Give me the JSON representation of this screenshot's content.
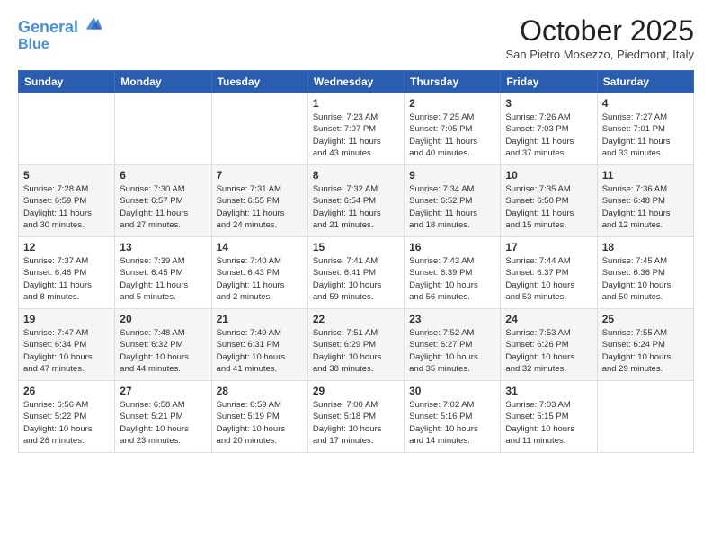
{
  "header": {
    "logo_line1": "General",
    "logo_line2": "Blue",
    "month_title": "October 2025",
    "location": "San Pietro Mosezzo, Piedmont, Italy"
  },
  "days_of_week": [
    "Sunday",
    "Monday",
    "Tuesday",
    "Wednesday",
    "Thursday",
    "Friday",
    "Saturday"
  ],
  "weeks": [
    [
      {
        "num": "",
        "info": ""
      },
      {
        "num": "",
        "info": ""
      },
      {
        "num": "",
        "info": ""
      },
      {
        "num": "1",
        "info": "Sunrise: 7:23 AM\nSunset: 7:07 PM\nDaylight: 11 hours\nand 43 minutes."
      },
      {
        "num": "2",
        "info": "Sunrise: 7:25 AM\nSunset: 7:05 PM\nDaylight: 11 hours\nand 40 minutes."
      },
      {
        "num": "3",
        "info": "Sunrise: 7:26 AM\nSunset: 7:03 PM\nDaylight: 11 hours\nand 37 minutes."
      },
      {
        "num": "4",
        "info": "Sunrise: 7:27 AM\nSunset: 7:01 PM\nDaylight: 11 hours\nand 33 minutes."
      }
    ],
    [
      {
        "num": "5",
        "info": "Sunrise: 7:28 AM\nSunset: 6:59 PM\nDaylight: 11 hours\nand 30 minutes."
      },
      {
        "num": "6",
        "info": "Sunrise: 7:30 AM\nSunset: 6:57 PM\nDaylight: 11 hours\nand 27 minutes."
      },
      {
        "num": "7",
        "info": "Sunrise: 7:31 AM\nSunset: 6:55 PM\nDaylight: 11 hours\nand 24 minutes."
      },
      {
        "num": "8",
        "info": "Sunrise: 7:32 AM\nSunset: 6:54 PM\nDaylight: 11 hours\nand 21 minutes."
      },
      {
        "num": "9",
        "info": "Sunrise: 7:34 AM\nSunset: 6:52 PM\nDaylight: 11 hours\nand 18 minutes."
      },
      {
        "num": "10",
        "info": "Sunrise: 7:35 AM\nSunset: 6:50 PM\nDaylight: 11 hours\nand 15 minutes."
      },
      {
        "num": "11",
        "info": "Sunrise: 7:36 AM\nSunset: 6:48 PM\nDaylight: 11 hours\nand 12 minutes."
      }
    ],
    [
      {
        "num": "12",
        "info": "Sunrise: 7:37 AM\nSunset: 6:46 PM\nDaylight: 11 hours\nand 8 minutes."
      },
      {
        "num": "13",
        "info": "Sunrise: 7:39 AM\nSunset: 6:45 PM\nDaylight: 11 hours\nand 5 minutes."
      },
      {
        "num": "14",
        "info": "Sunrise: 7:40 AM\nSunset: 6:43 PM\nDaylight: 11 hours\nand 2 minutes."
      },
      {
        "num": "15",
        "info": "Sunrise: 7:41 AM\nSunset: 6:41 PM\nDaylight: 10 hours\nand 59 minutes."
      },
      {
        "num": "16",
        "info": "Sunrise: 7:43 AM\nSunset: 6:39 PM\nDaylight: 10 hours\nand 56 minutes."
      },
      {
        "num": "17",
        "info": "Sunrise: 7:44 AM\nSunset: 6:37 PM\nDaylight: 10 hours\nand 53 minutes."
      },
      {
        "num": "18",
        "info": "Sunrise: 7:45 AM\nSunset: 6:36 PM\nDaylight: 10 hours\nand 50 minutes."
      }
    ],
    [
      {
        "num": "19",
        "info": "Sunrise: 7:47 AM\nSunset: 6:34 PM\nDaylight: 10 hours\nand 47 minutes."
      },
      {
        "num": "20",
        "info": "Sunrise: 7:48 AM\nSunset: 6:32 PM\nDaylight: 10 hours\nand 44 minutes."
      },
      {
        "num": "21",
        "info": "Sunrise: 7:49 AM\nSunset: 6:31 PM\nDaylight: 10 hours\nand 41 minutes."
      },
      {
        "num": "22",
        "info": "Sunrise: 7:51 AM\nSunset: 6:29 PM\nDaylight: 10 hours\nand 38 minutes."
      },
      {
        "num": "23",
        "info": "Sunrise: 7:52 AM\nSunset: 6:27 PM\nDaylight: 10 hours\nand 35 minutes."
      },
      {
        "num": "24",
        "info": "Sunrise: 7:53 AM\nSunset: 6:26 PM\nDaylight: 10 hours\nand 32 minutes."
      },
      {
        "num": "25",
        "info": "Sunrise: 7:55 AM\nSunset: 6:24 PM\nDaylight: 10 hours\nand 29 minutes."
      }
    ],
    [
      {
        "num": "26",
        "info": "Sunrise: 6:56 AM\nSunset: 5:22 PM\nDaylight: 10 hours\nand 26 minutes."
      },
      {
        "num": "27",
        "info": "Sunrise: 6:58 AM\nSunset: 5:21 PM\nDaylight: 10 hours\nand 23 minutes."
      },
      {
        "num": "28",
        "info": "Sunrise: 6:59 AM\nSunset: 5:19 PM\nDaylight: 10 hours\nand 20 minutes."
      },
      {
        "num": "29",
        "info": "Sunrise: 7:00 AM\nSunset: 5:18 PM\nDaylight: 10 hours\nand 17 minutes."
      },
      {
        "num": "30",
        "info": "Sunrise: 7:02 AM\nSunset: 5:16 PM\nDaylight: 10 hours\nand 14 minutes."
      },
      {
        "num": "31",
        "info": "Sunrise: 7:03 AM\nSunset: 5:15 PM\nDaylight: 10 hours\nand 11 minutes."
      },
      {
        "num": "",
        "info": ""
      }
    ]
  ]
}
